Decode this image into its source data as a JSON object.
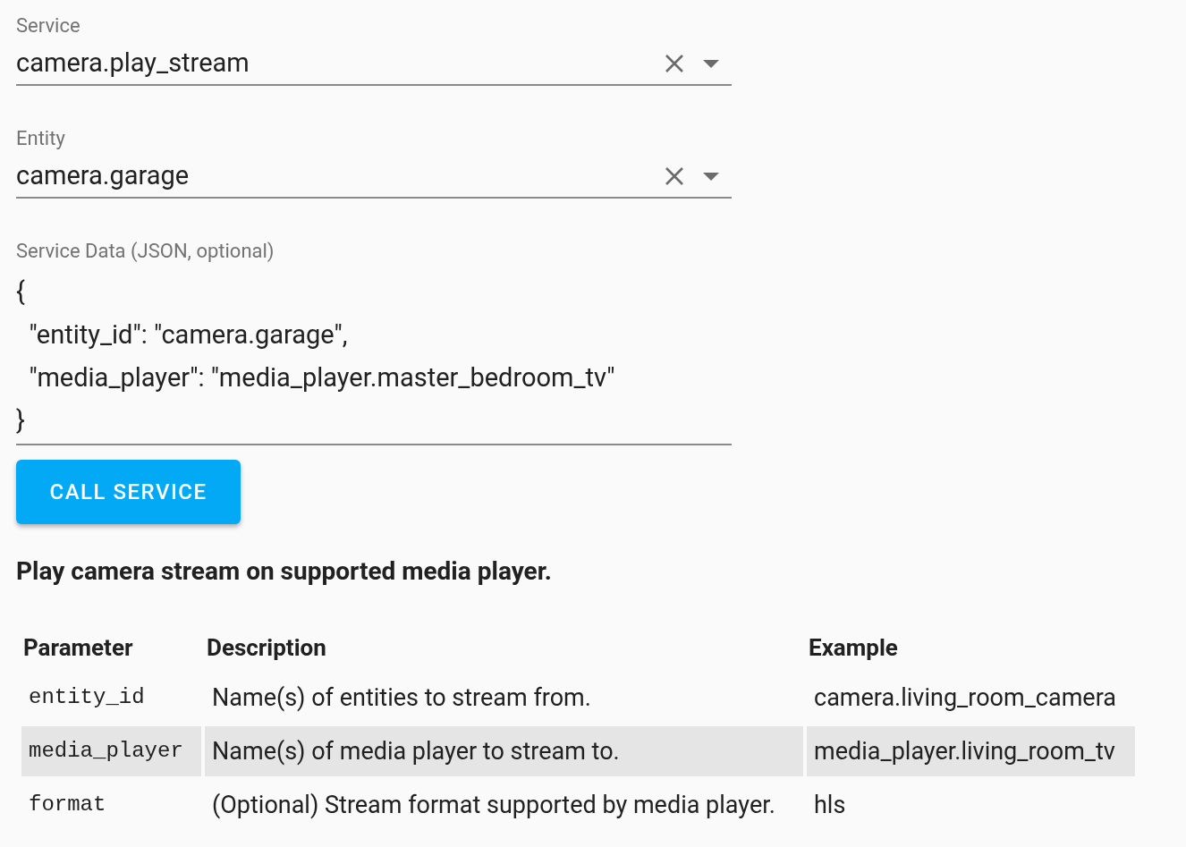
{
  "fields": [
    {
      "kind": "combo",
      "label": "Service",
      "value": "camera.play_stream"
    },
    {
      "kind": "combo",
      "label": "Entity",
      "value": "camera.garage"
    },
    {
      "kind": "textarea",
      "label": "Service Data (JSON, optional)",
      "value": "{\n  \"entity_id\": \"camera.garage\",\n  \"media_player\": \"media_player.master_bedroom_tv\"\n}"
    }
  ],
  "button": "CALL SERVICE",
  "description": "Play camera stream on supported media player.",
  "table": {
    "columns": [
      "Parameter",
      "Description",
      "Example"
    ],
    "rows": [
      {
        "highlighted": false,
        "cells": [
          "entity_id",
          "Name(s) of entities to stream from.",
          "camera.living_room_camera"
        ]
      },
      {
        "highlighted": true,
        "cells": [
          "media_player",
          "Name(s) of media player to stream to.",
          "media_player.living_room_tv"
        ]
      },
      {
        "highlighted": false,
        "cells": [
          "format",
          "(Optional) Stream format supported by media player.",
          "hls"
        ]
      }
    ]
  }
}
